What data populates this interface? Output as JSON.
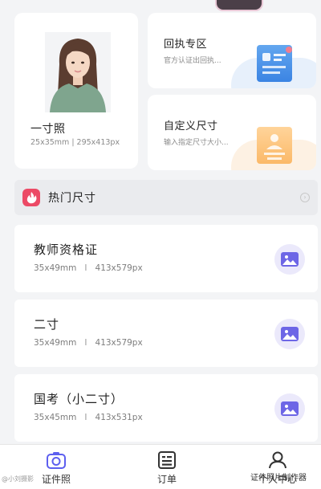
{
  "cards": {
    "main": {
      "title": "一寸照",
      "size": "25x35mm | 295x413px"
    },
    "receipt": {
      "title": "回执专区",
      "desc": "官方认证出回执..."
    },
    "custom": {
      "title": "自定义尺寸",
      "desc": "输入指定尺寸大小..."
    }
  },
  "hot": {
    "label": "热门尺寸",
    "more_icon": "chevron-right-icon"
  },
  "list": [
    {
      "title": "教师资格证",
      "mm": "35x49mm",
      "sep": "I",
      "px": "413x579px"
    },
    {
      "title": "二寸",
      "mm": "35x49mm",
      "sep": "I",
      "px": "413x579px"
    },
    {
      "title": "国考（小二寸）",
      "mm": "35x45mm",
      "sep": "I",
      "px": "413x531px"
    }
  ],
  "tabs": [
    {
      "label": "证件照",
      "icon": "camera-icon",
      "active": true
    },
    {
      "label": "订单",
      "icon": "order-list-icon",
      "active": false
    },
    {
      "label": "个人中心",
      "icon": "user-icon",
      "active": false
    }
  ],
  "watermarks": {
    "left": "@小刘摄影",
    "right": "证件照片制作器"
  },
  "colors": {
    "accent": "#5d5fef",
    "hot_icon": "#ec4a66",
    "doc_blue": "#3b84e3",
    "doc_orange": "#fbb968"
  }
}
